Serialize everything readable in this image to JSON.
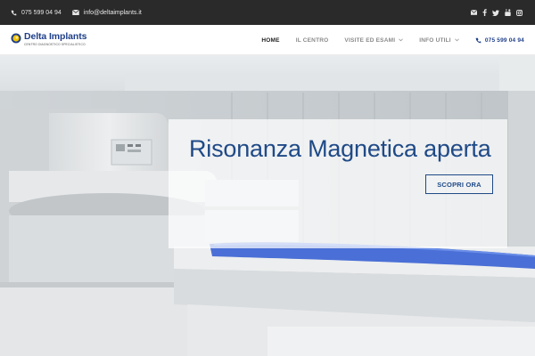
{
  "topbar": {
    "phone": "075 599 04 94",
    "email": "info@deltaimplants.it",
    "social_icons": [
      "mail-icon",
      "facebook-icon",
      "twitter-icon",
      "youtube-icon",
      "instagram-icon"
    ]
  },
  "header": {
    "logo_name": "Delta Implants",
    "logo_tagline": "Centro diagnostico specialistico",
    "nav": [
      {
        "label": "Home",
        "active": true
      },
      {
        "label": "Il Centro"
      },
      {
        "label": "Visite ed Esami",
        "dropdown": true
      },
      {
        "label": "Info Utili",
        "dropdown": true
      }
    ],
    "nav_phone": "075 599 04 94"
  },
  "hero": {
    "headline": "Risonanza Magnetica aperta",
    "cta_label": "SCOPRI ORA"
  },
  "colors": {
    "brand_blue": "#1f4a87",
    "topbar_bg": "#2a2a2a",
    "logo_yellow": "#f2c400"
  }
}
